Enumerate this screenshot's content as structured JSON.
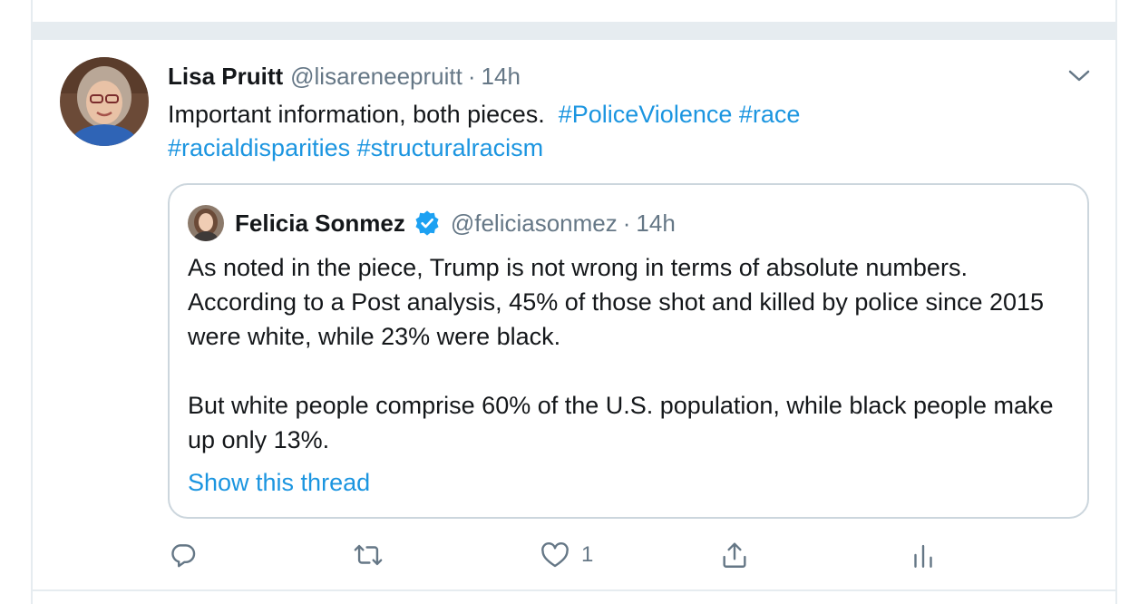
{
  "tweet": {
    "author_name": "Lisa Pruitt",
    "author_handle": "@lisareneepruitt",
    "separator": "·",
    "time": "14h",
    "text_intro": "Important information, both pieces.",
    "hashtags": [
      "#PoliceViolence",
      "#race",
      "#racialdisparities",
      "#structuralracism"
    ]
  },
  "quoted_tweet": {
    "author_name": "Felicia Sonmez",
    "author_handle": "@feliciasonmez",
    "separator": "·",
    "time": "14h",
    "paragraphs": [
      "As noted in the piece, Trump is not wrong in terms of absolute numbers.  According to a Post analysis, 45% of those shot and killed by police since 2015 were white, while 23% were black.",
      "But white people comprise 60% of the U.S. population, while black people make up only 13%."
    ],
    "show_thread": "Show this thread"
  },
  "actions": {
    "like_count": "1"
  },
  "icons": [
    "chevron-down-icon",
    "verified-badge-icon",
    "reply-icon",
    "retweet-icon",
    "like-icon",
    "share-icon",
    "analytics-icon"
  ],
  "colors": {
    "link": "#1b95e0",
    "secondary_text": "#657786",
    "divider": "#e6ecf0",
    "verified": "#1da1f2"
  }
}
